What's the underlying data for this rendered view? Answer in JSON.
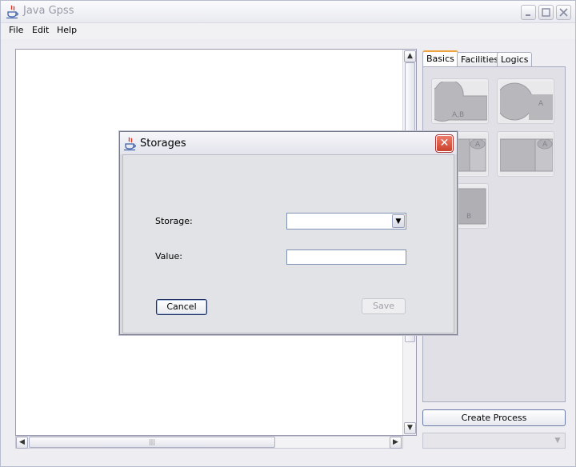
{
  "window": {
    "title": "Java Gpss",
    "minimize_icon": "minimize-icon",
    "maximize_icon": "maximize-icon",
    "close_icon": "close-icon"
  },
  "menu": {
    "items": [
      {
        "label": "File"
      },
      {
        "label": "Edit"
      },
      {
        "label": "Help"
      }
    ]
  },
  "palette": {
    "tabs": [
      {
        "label": "Basics",
        "selected": true
      },
      {
        "label": "Facilities",
        "selected": false
      },
      {
        "label": "Logics",
        "selected": false
      }
    ],
    "tiles": [
      {
        "label": "A,B"
      },
      {
        "label": "A"
      },
      {
        "label": "A"
      },
      {
        "label": "A"
      },
      {
        "label": "B"
      }
    ],
    "create_process_label": "Create Process"
  },
  "dialog": {
    "title": "Storages",
    "storage_label": "Storage:",
    "value_label": "Value:",
    "storage_value": "",
    "value_value": "",
    "cancel_label": "Cancel",
    "save_label": "Save"
  },
  "scroll": {
    "h_thumb_grip": "|||"
  },
  "colors": {
    "active_tab_accent": "#f0a33c",
    "close_button": "#c9412c"
  }
}
